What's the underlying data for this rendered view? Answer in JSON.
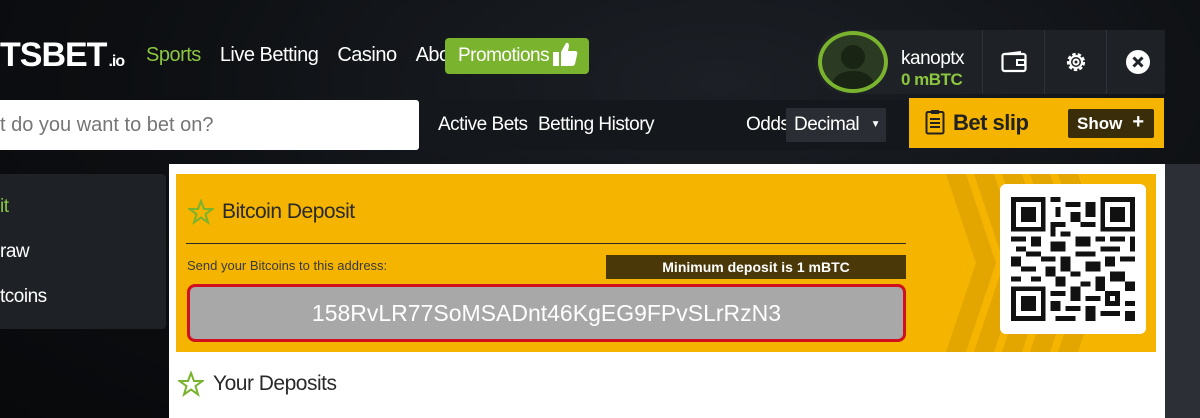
{
  "header": {
    "logo_main": "TSBET",
    "logo_suffix": ".io",
    "nav": [
      "Sports",
      "Live Betting",
      "Casino",
      "About"
    ],
    "promotions_label": "Promotions"
  },
  "user": {
    "username": "kanoptx",
    "balance": "0 mBTC"
  },
  "search": {
    "placeholder": "t do you want to bet on?"
  },
  "subnav": {
    "active_bets": "Active Bets",
    "betting_history": "Betting History",
    "odds_label": "Odds",
    "odds_value": "Decimal"
  },
  "betslip": {
    "title": "Bet slip",
    "show_label": "Show"
  },
  "sidebar": {
    "items": [
      "it",
      "raw",
      "tcoins"
    ]
  },
  "deposit": {
    "title": "Bitcoin Deposit",
    "send_label": "Send your Bitcoins to this address:",
    "minimum": "Minimum deposit is 1 mBTC",
    "address": "158RvLR77SoMSADnt46KgEG9FPvSLrRzN3"
  },
  "your_deposits": {
    "title": "Your Deposits"
  },
  "colors": {
    "brand_green": "#7ab32e",
    "accent_yellow": "#f5b400",
    "dark_panel": "#1e2227",
    "address_border": "#d0101e"
  }
}
